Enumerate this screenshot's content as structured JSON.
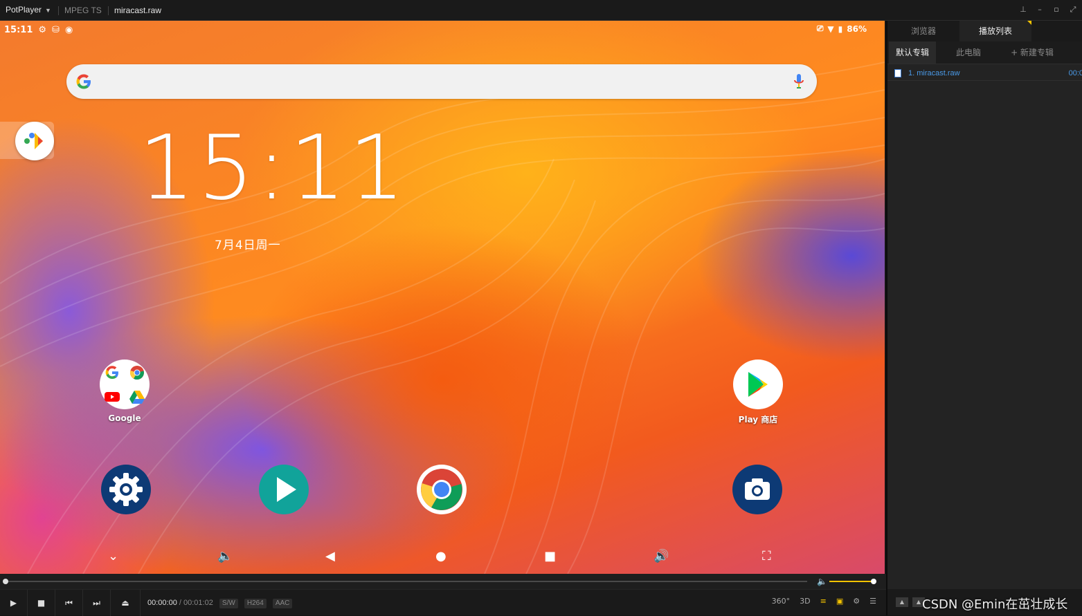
{
  "titlebar": {
    "app_name": "PotPlayer",
    "format": "MPEG TS",
    "filename": "miracast.raw"
  },
  "android": {
    "status_time": "15:11",
    "battery": "86%",
    "clock": "15:11",
    "date": "7月4日周一",
    "apps": {
      "google_folder_label": "Google",
      "play_store_label": "Play 商店"
    }
  },
  "playback": {
    "current_time": "00:00:00",
    "separator": "/",
    "duration": "00:01:02",
    "tag_sw": "S/W",
    "tag_video": "H264",
    "tag_audio": "AAC",
    "position_fraction": 0.0,
    "volume_fraction": 1.0,
    "btn_360": "360°",
    "btn_3d": "3D"
  },
  "panel": {
    "tabs": [
      "浏览器",
      "播放列表"
    ],
    "subtabs": [
      "默认专辑",
      "此电脑",
      "+ 新建专辑"
    ],
    "playlist": [
      {
        "name": "1. miracast.raw",
        "duration": "00:0"
      }
    ]
  },
  "watermark": "CSDN @Emin在茁壮成长",
  "colors": {
    "accent": "#f5c400",
    "playlist_text": "#4a9ae8",
    "background": "#1a1a1a"
  }
}
